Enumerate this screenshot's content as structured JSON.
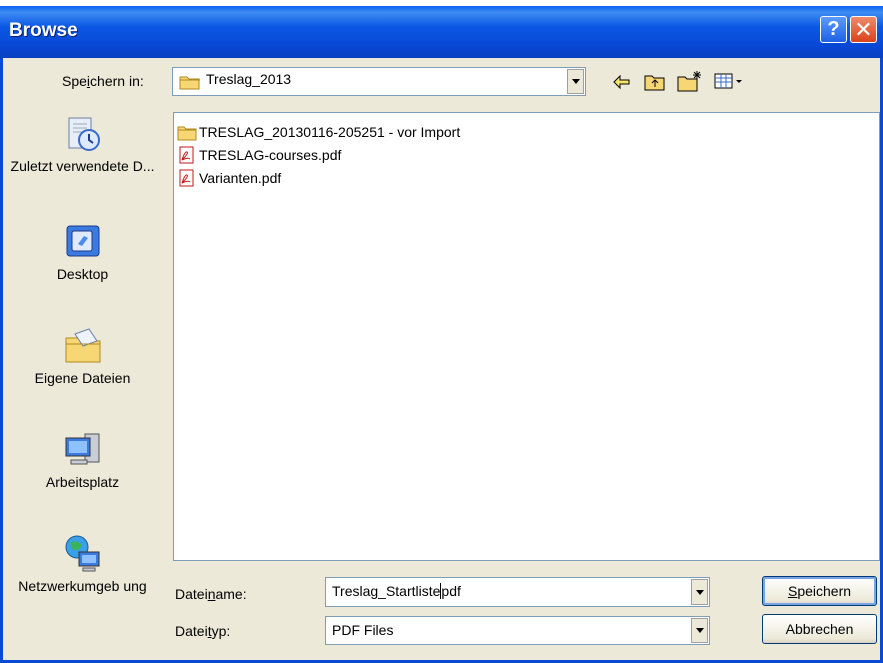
{
  "window": {
    "title": "Browse"
  },
  "titlebar": {
    "help_glyph": "?",
    "close_glyph": "✕"
  },
  "location": {
    "label_pre": "Spe",
    "label_u": "i",
    "label_post": "chern in:",
    "current_folder": "Treslag_2013"
  },
  "toolbar": {
    "back_icon": "back-arrow-icon",
    "up_icon": "folder-up-icon",
    "new_folder_icon": "new-folder-icon",
    "view_menu_icon": "view-menu-icon"
  },
  "places": [
    {
      "label": "Zuletzt verwendete D...",
      "icon": "recent-documents-icon"
    },
    {
      "label": "Desktop",
      "icon": "desktop-icon"
    },
    {
      "label": "Eigene Dateien",
      "icon": "my-documents-icon"
    },
    {
      "label": "Arbeitsplatz",
      "icon": "my-computer-icon"
    },
    {
      "label": "Netzwerkumgeb ung",
      "icon": "network-places-icon"
    }
  ],
  "files": [
    {
      "name": "TRESLAG_20130116-205251 - vor Import",
      "type": "folder"
    },
    {
      "name": "TRESLAG-courses.pdf",
      "type": "pdf"
    },
    {
      "name": "Varianten.pdf",
      "type": "pdf"
    }
  ],
  "filename": {
    "label_pre": "Datei",
    "label_u": "n",
    "label_post": "ame:",
    "value_before_cursor": "Treslag_Startliste",
    "value_after_cursor": "pdf"
  },
  "filetype": {
    "label_pre": "Datei",
    "label_u": "t",
    "label_post": "yp:",
    "selected": "PDF Files"
  },
  "buttons": {
    "save_u": "S",
    "save_rest": "peichern",
    "cancel": "Abbrechen"
  },
  "colors": {
    "titlebar": "#0a58e4",
    "dialog_bg": "#ece9d8",
    "border": "#7f9db9"
  }
}
